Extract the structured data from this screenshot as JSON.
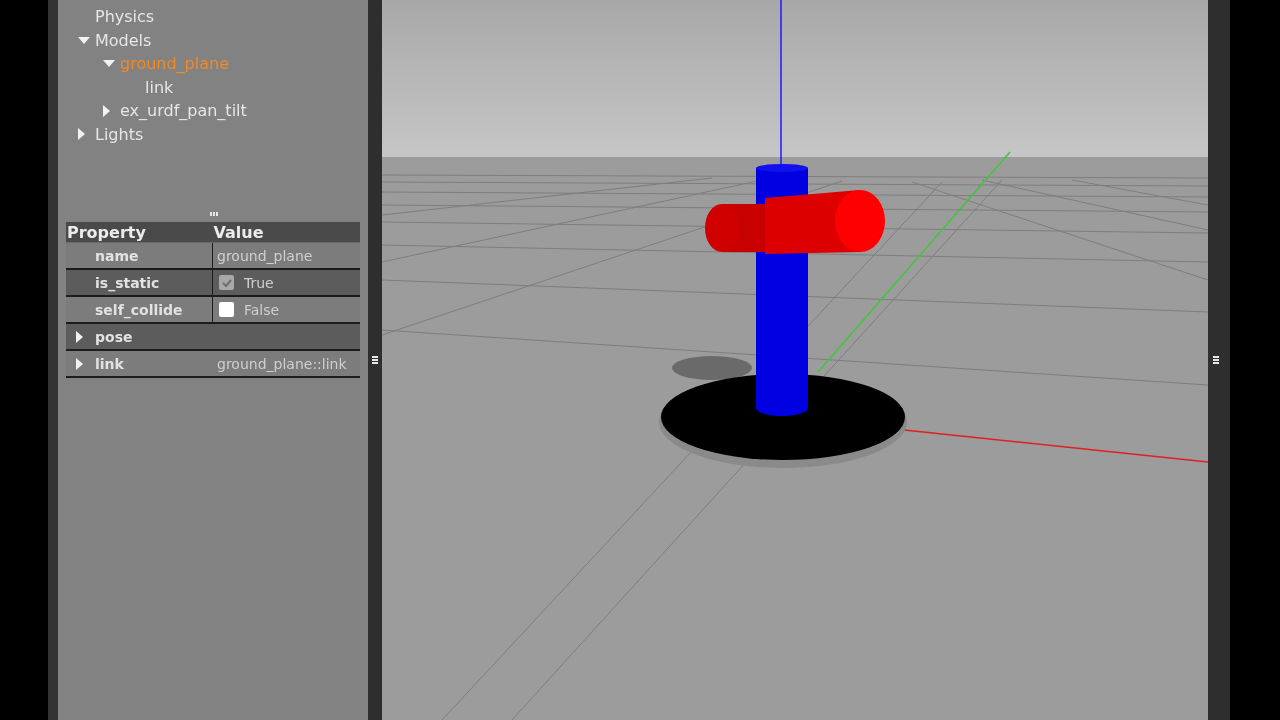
{
  "world_tree": [
    {
      "label": "Physics",
      "selected": false
    },
    {
      "label": "Models",
      "expanded": true,
      "selected": false,
      "children": [
        {
          "label": "ground_plane",
          "expanded": true,
          "selected": true,
          "children": [
            {
              "label": "link",
              "selected": false
            }
          ]
        },
        {
          "label": "ex_urdf_pan_tilt",
          "expanded": false,
          "selected": false
        }
      ]
    },
    {
      "label": "Lights",
      "expanded": false,
      "selected": false
    }
  ],
  "property_table": {
    "columns": [
      "Property",
      "Value"
    ],
    "rows": [
      {
        "kind": "text",
        "property": "name",
        "value": "ground_plane"
      },
      {
        "kind": "checkbox",
        "property": "is_static",
        "checked": true,
        "value": "True"
      },
      {
        "kind": "checkbox",
        "property": "self_collide",
        "checked": false,
        "value": "False"
      },
      {
        "kind": "group",
        "property": "pose",
        "expanded": false
      },
      {
        "kind": "group",
        "property": "link",
        "expanded": false,
        "value": "ground_plane::link"
      }
    ]
  }
}
